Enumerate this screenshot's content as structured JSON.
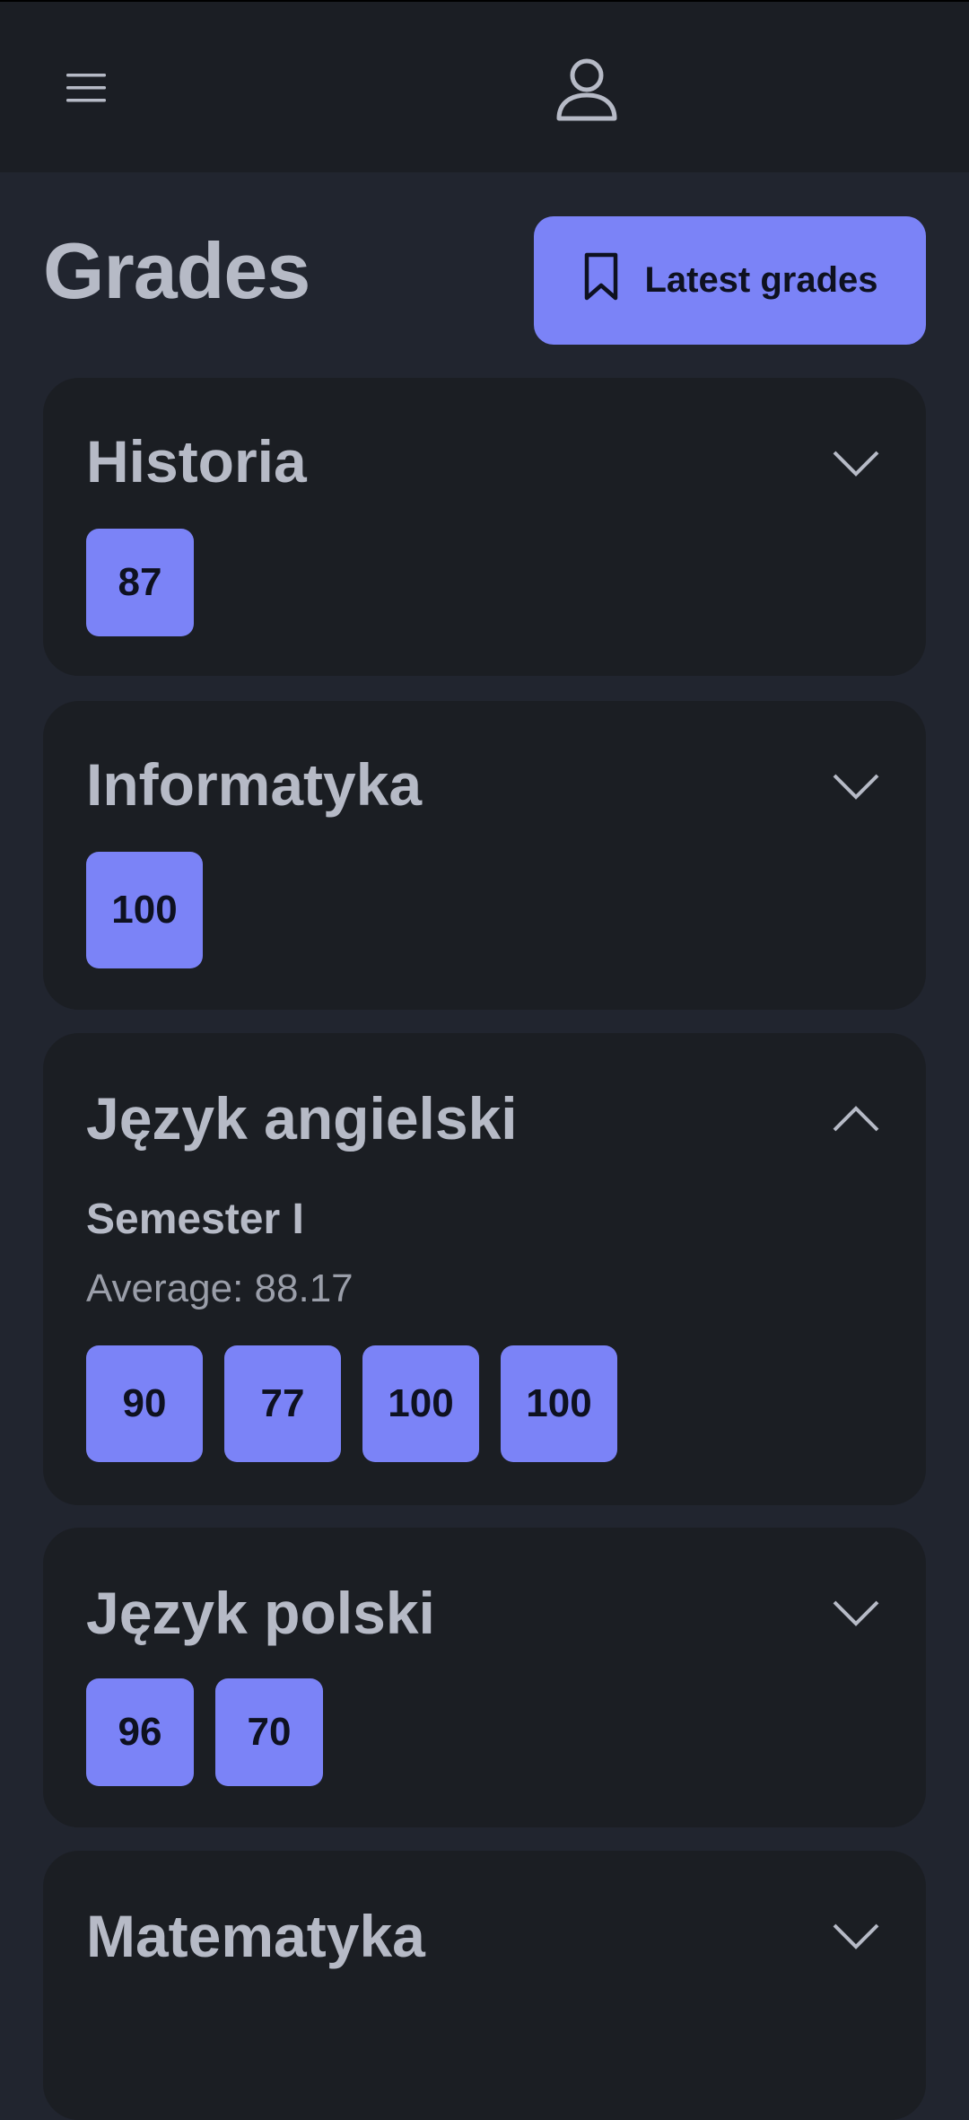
{
  "header": {
    "menu_icon": "hamburger-menu-icon",
    "profile_icon": "user-profile-icon"
  },
  "page": {
    "title": "Grades",
    "latest_button": {
      "label": "Latest grades",
      "icon": "bookmark-icon"
    }
  },
  "colors": {
    "accent": "#7b83f7",
    "background": "#21252f",
    "card": "#1b1e23",
    "header": "#1b1e24",
    "text": "#b6bac6"
  },
  "subjects": [
    {
      "name": "Historia",
      "expanded": false,
      "grades": [
        "87"
      ]
    },
    {
      "name": "Informatyka",
      "expanded": false,
      "grades": [
        "100"
      ]
    },
    {
      "name": "Język angielski",
      "expanded": true,
      "semester": "Semester I",
      "average": "Average: 88.17",
      "grades": [
        "90",
        "77",
        "100",
        "100"
      ]
    },
    {
      "name": "Język polski",
      "expanded": false,
      "grades": [
        "96",
        "70"
      ]
    },
    {
      "name": "Matematyka",
      "expanded": false,
      "grades": []
    }
  ]
}
